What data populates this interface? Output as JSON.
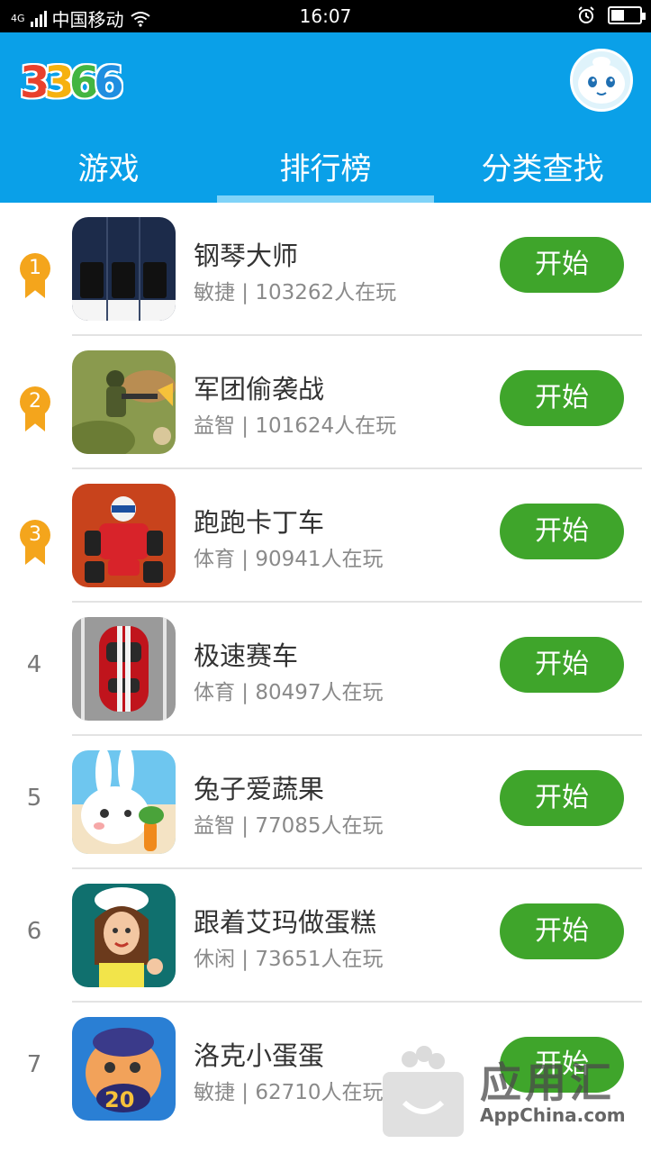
{
  "status_bar": {
    "network": "4G",
    "carrier": "中国移动",
    "time": "16:07",
    "battery_level": 0.45
  },
  "header": {
    "logo_text": "3366",
    "logo_colors": [
      "#e8412d",
      "#f6b10f",
      "#43b541",
      "#1f8ee0"
    ],
    "tabs": [
      {
        "label": "游戏",
        "active": false
      },
      {
        "label": "排行榜",
        "active": true
      },
      {
        "label": "分类查找",
        "active": false
      }
    ]
  },
  "games": [
    {
      "rank": "1",
      "name": "钢琴大师",
      "category": "敏捷",
      "players": "103262人在玩",
      "button": "开始"
    },
    {
      "rank": "2",
      "name": "军团偷袭战",
      "category": "益智",
      "players": "101624人在玩",
      "button": "开始"
    },
    {
      "rank": "3",
      "name": "跑跑卡丁车",
      "category": "体育",
      "players": "90941人在玩",
      "button": "开始"
    },
    {
      "rank": "4",
      "name": "极速赛车",
      "category": "体育",
      "players": "80497人在玩",
      "button": "开始"
    },
    {
      "rank": "5",
      "name": "兔子爱蔬果",
      "category": "益智",
      "players": "77085人在玩",
      "button": "开始"
    },
    {
      "rank": "6",
      "name": "跟着艾玛做蛋糕",
      "category": "休闲",
      "players": "73651人在玩",
      "button": "开始"
    },
    {
      "rank": "7",
      "name": "洛克小蛋蛋",
      "category": "敏捷",
      "players": "62710人在玩",
      "button": "开始"
    }
  ],
  "watermark": {
    "title": "应用汇",
    "subtitle": "AppChina.com"
  },
  "colors": {
    "header": "#0aa0e8",
    "button": "#3fa52b",
    "medal": "#f4a51c"
  }
}
